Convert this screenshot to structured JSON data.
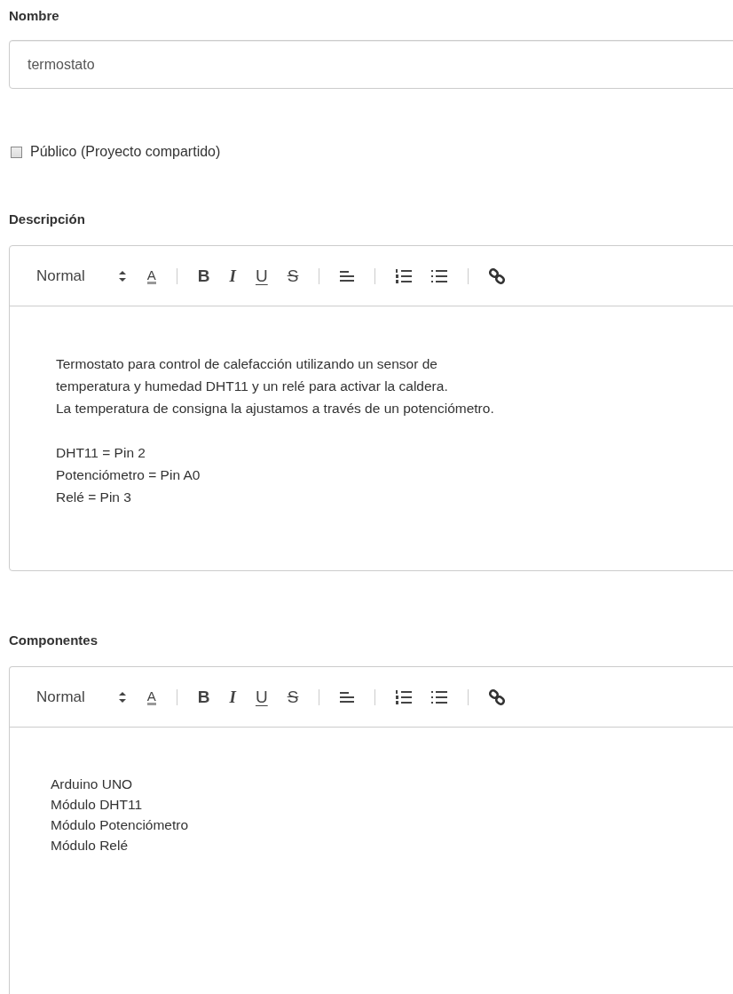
{
  "name_field": {
    "label": "Nombre",
    "value": "termostato"
  },
  "public_checkbox": {
    "label": "Público (Proyecto compartido)",
    "checked": false
  },
  "editors": [
    {
      "label": "Descripción",
      "toolbar": [
        {
          "kind": "picker",
          "label": "Normal"
        },
        {
          "kind": "color",
          "glyph": "A"
        },
        {
          "kind": "separator"
        },
        {
          "kind": "bold",
          "glyph": "B"
        },
        {
          "kind": "italic",
          "glyph": "I"
        },
        {
          "kind": "underline",
          "glyph": "U"
        },
        {
          "kind": "strike",
          "glyph": "S"
        },
        {
          "kind": "separator"
        },
        {
          "kind": "align"
        },
        {
          "kind": "separator"
        },
        {
          "kind": "ordered-list"
        },
        {
          "kind": "bullet-list"
        },
        {
          "kind": "separator"
        },
        {
          "kind": "link"
        }
      ],
      "paragraphs": [
        [
          "Termostato para control de calefacción utilizando un sensor de",
          "temperatura y humedad DHT11 y un relé para activar la caldera.",
          "La temperatura de consigna la ajustamos a través de un potenciómetro."
        ],
        [
          "DHT11 = Pin 2",
          "Potenciómetro = Pin A0",
          "Relé = Pin 3"
        ]
      ]
    },
    {
      "label": "Componentes",
      "toolbar": [
        {
          "kind": "picker",
          "label": "Normal"
        },
        {
          "kind": "color",
          "glyph": "A"
        },
        {
          "kind": "separator"
        },
        {
          "kind": "bold",
          "glyph": "B"
        },
        {
          "kind": "italic",
          "glyph": "I"
        },
        {
          "kind": "underline",
          "glyph": "U"
        },
        {
          "kind": "strike",
          "glyph": "S"
        },
        {
          "kind": "separator"
        },
        {
          "kind": "align"
        },
        {
          "kind": "separator"
        },
        {
          "kind": "ordered-list"
        },
        {
          "kind": "bullet-list"
        },
        {
          "kind": "separator"
        },
        {
          "kind": "link"
        }
      ],
      "paragraphs": [
        [
          "Arduino UNO",
          "Módulo DHT11",
          "Módulo Potenciómetro",
          "Módulo Relé"
        ]
      ]
    }
  ]
}
